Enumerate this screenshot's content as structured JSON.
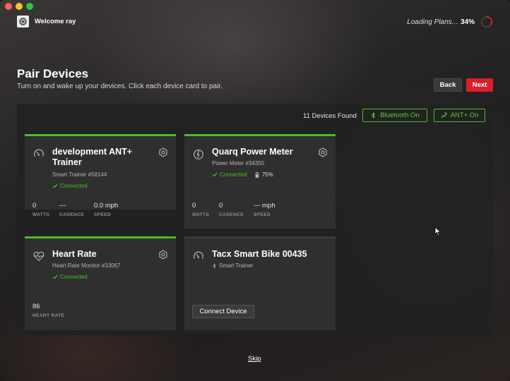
{
  "header": {
    "welcome": "Welcome ray",
    "loading_text": "Loading Plans...",
    "loading_percent": "34%",
    "loading_progress": 0.34
  },
  "page": {
    "title": "Pair Devices",
    "subtitle": "Turn on and wake up your devices. Click each device card to pair.",
    "back_label": "Back",
    "next_label": "Next",
    "skip_label": "Skip"
  },
  "toolbar": {
    "devices_found": "11 Devices Found",
    "bluetooth_label": "Bluetooth On",
    "ant_label": "ANT+ On"
  },
  "devices": [
    {
      "title": "development ANT+ Trainer",
      "subtitle": "Smart Trainer #58144",
      "status": "Connected",
      "icon": "trainer-icon",
      "metrics": [
        {
          "value": "0",
          "label": "WATTS"
        },
        {
          "value": "---",
          "label": "CADENCE"
        },
        {
          "value": "0.0 mph",
          "label": "SPEED"
        }
      ]
    },
    {
      "title": "Quarq Power Meter",
      "subtitle": "Power Meter #34355",
      "status": "Connected",
      "battery": "75%",
      "icon": "power-meter-icon",
      "metrics": [
        {
          "value": "0",
          "label": "WATTS"
        },
        {
          "value": "0",
          "label": "CADENCE"
        },
        {
          "value": "--- mph",
          "label": "SPEED"
        }
      ]
    },
    {
      "title": "Heart Rate",
      "subtitle": "Heart Rate Monitor #33067",
      "status": "Connected",
      "icon": "heart-rate-icon",
      "metrics": [
        {
          "value": "86",
          "label": "HEART RATE"
        }
      ]
    },
    {
      "title": "Tacx Smart Bike 00435",
      "subtitle": "Smart Trainer",
      "icon": "trainer-icon",
      "connect_label": "Connect Device"
    }
  ],
  "colors": {
    "accent_green": "#4cba2e",
    "next_red": "#d7202a"
  }
}
